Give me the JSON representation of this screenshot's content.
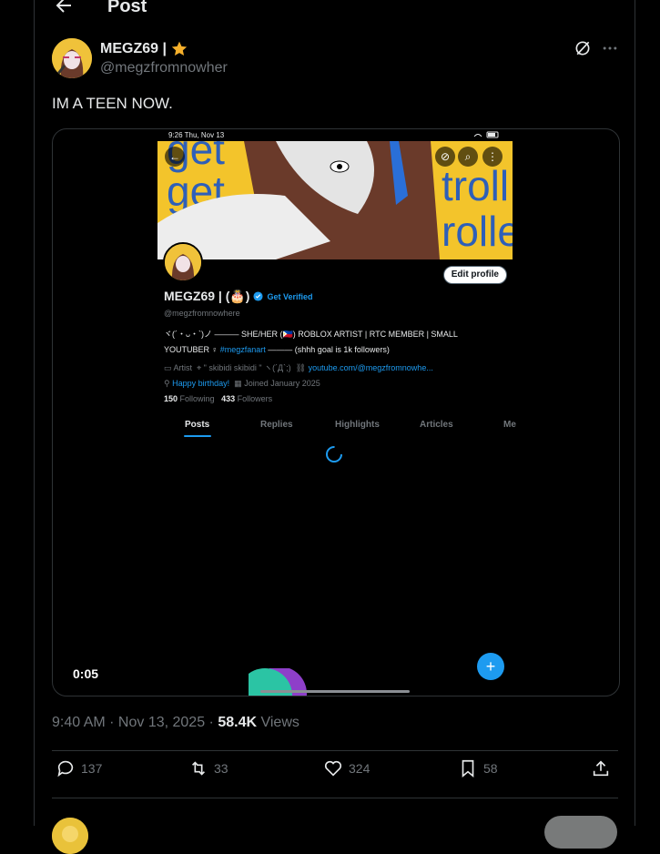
{
  "header": {
    "title": "Post"
  },
  "author": {
    "display_name": "MEGZ69 |",
    "handle": "@megzfromnowher"
  },
  "post": {
    "text": "IM A TEEN NOW."
  },
  "video": {
    "elapsed": "0:05"
  },
  "embedded_profile": {
    "status_time": "9:26  Thu, Nov 13",
    "banner_words": [
      "get",
      "get",
      "troll",
      "rolle"
    ],
    "edit_button": "Edit profile",
    "name": "MEGZ69 | (🎂)",
    "get_verified": "Get Verified",
    "handle": "@megzfromnowhere",
    "bio_line1": "ヾ(´・ᴗ・`)ノ ——— SHE/HER (🇵🇭) ROBLOX ARTIST | RTC MEMBER | SMALL",
    "bio_line2_prefix": "YOUTUBER ♀ ",
    "bio_hashtag": "#megzfanart",
    "bio_line2_suffix": " ——— (shhh goal is 1k followers)",
    "meta_location_label": "Artist",
    "meta_location": "\" skibidi skibidi \" ヽ(´Д`;)",
    "meta_link": "youtube.com/@megzfromnowhe...",
    "meta_birthday": "Happy birthday!",
    "meta_joined": "Joined January 2025",
    "following_count": "150",
    "following_label": "Following",
    "followers_count": "433",
    "followers_label": "Followers",
    "tabs": [
      "Posts",
      "Replies",
      "Highlights",
      "Articles",
      "Me"
    ],
    "fab": "+"
  },
  "meta": {
    "time": "9:40 AM",
    "date": "Nov 13, 2025",
    "views_count": "58.4K",
    "views_label": "Views"
  },
  "actions": {
    "replies": "137",
    "reposts": "33",
    "likes": "324",
    "bookmarks": "58"
  },
  "colors": {
    "accent": "#1d9bf0",
    "verified_star": "#f6b02b",
    "background": "#000000"
  }
}
